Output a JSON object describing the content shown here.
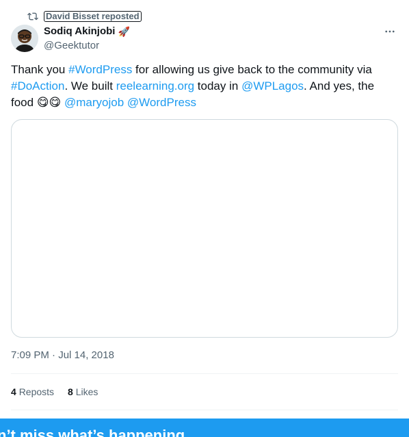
{
  "repost": {
    "text": "David Bisset reposted",
    "icon": "repost-icon"
  },
  "author": {
    "display_name": "Sodiq Akinjobi",
    "name_emoji": "🚀",
    "handle": "@Geektutor"
  },
  "tweet": {
    "segments": [
      {
        "text": "Thank you ",
        "link": false
      },
      {
        "text": "#WordPress",
        "link": true
      },
      {
        "text": " for allowing us give back to the community via ",
        "link": false
      },
      {
        "text": "#DoAction",
        "link": true
      },
      {
        "text": ". We built ",
        "link": false
      },
      {
        "text": "reelearning.org",
        "link": true
      },
      {
        "text": " today in ",
        "link": false
      },
      {
        "text": "@WPLagos",
        "link": true
      },
      {
        "text": ". And yes, the food ",
        "link": false
      },
      {
        "text": "😋😋",
        "link": false
      },
      {
        "text": " ",
        "link": false
      },
      {
        "text": "@maryojob",
        "link": true
      },
      {
        "text": " ",
        "link": false
      },
      {
        "text": "@WordPress",
        "link": true
      }
    ]
  },
  "meta": {
    "timestamp": "7:09 PM · Jul 14, 2018"
  },
  "stats": {
    "reposts_count": "4",
    "reposts_label": "Reposts",
    "likes_count": "8",
    "likes_label": "Likes"
  },
  "banner": {
    "text": "n’t miss what’s happening"
  },
  "colors": {
    "accent": "#1d9bf0",
    "text": "#0f1419",
    "secondary": "#536471"
  }
}
